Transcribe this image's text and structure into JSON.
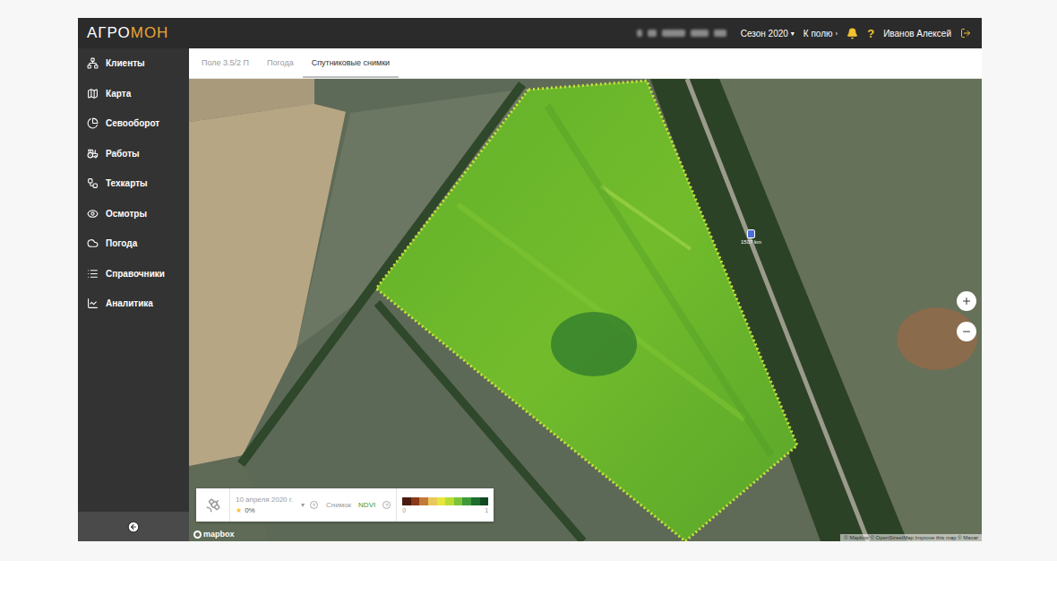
{
  "app": {
    "logo_primary": "АГРО",
    "logo_accent": "МОН"
  },
  "topbar": {
    "season": "Сезон 2020",
    "season_caret": "▾",
    "to_field": "К полю",
    "to_field_caret": "›",
    "help": "?",
    "user": "Иванов Алексей"
  },
  "sidebar": {
    "items": [
      {
        "label": "Клиенты",
        "selected": false
      },
      {
        "label": "Карта",
        "selected": false
      },
      {
        "label": "Севооборот",
        "selected": false
      },
      {
        "label": "Работы",
        "selected": false
      },
      {
        "label": "Техкарты",
        "selected": false
      },
      {
        "label": "Осмотры",
        "selected": false
      },
      {
        "label": "Погода",
        "selected": false
      },
      {
        "label": "Справочники",
        "selected": false
      },
      {
        "label": "Аналитика",
        "selected": false
      }
    ]
  },
  "tabs": [
    {
      "label": "Поле 3.5/2 П",
      "selected": false
    },
    {
      "label": "Погода",
      "selected": false
    },
    {
      "label": "Спутниковые снимки",
      "selected": true
    }
  ],
  "map": {
    "marker": "1507 km",
    "zoom_in": "+",
    "zoom_out": "−",
    "logo": "mapbox",
    "attribution": "© Mapbox © OpenStreetMap Improve this map © Maxar"
  },
  "image_panel": {
    "date": "10 апреля 2020 г.",
    "cloud_mark": "★",
    "cloud": "0%",
    "caret": "▾",
    "help": "?",
    "kind_label": "Снимок",
    "index": "NDVI",
    "index_help": "?",
    "legend_min": "0",
    "legend_max": "1",
    "scale": [
      "#4a1c10",
      "#8b3a1c",
      "#c27a3a",
      "#e8c85a",
      "#e6e63c",
      "#b8dc34",
      "#7cc43a",
      "#3f9a3a",
      "#1f6e2e",
      "#0f4a24"
    ]
  }
}
